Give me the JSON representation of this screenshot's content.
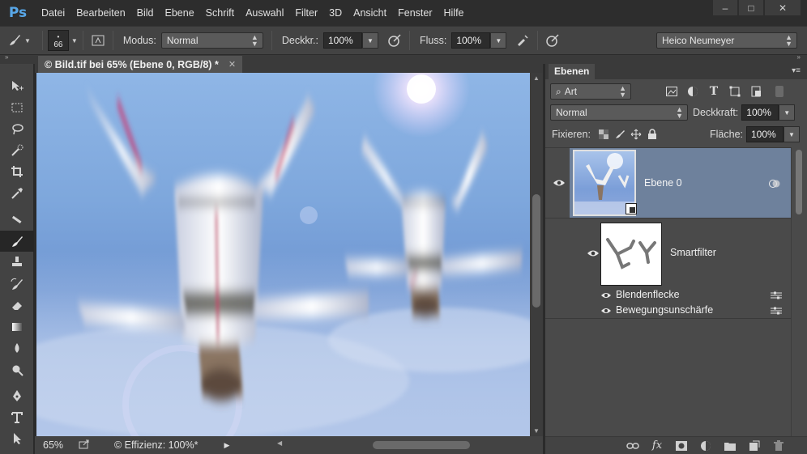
{
  "app": {
    "logo": "Ps"
  },
  "menu": [
    "Datei",
    "Bearbeiten",
    "Bild",
    "Ebene",
    "Schrift",
    "Auswahl",
    "Filter",
    "3D",
    "Ansicht",
    "Fenster",
    "Hilfe"
  ],
  "window_controls": {
    "minimize": "–",
    "maximize": "□",
    "close": "✕"
  },
  "options": {
    "brush_size": "66",
    "mode_label": "Modus:",
    "mode_value": "Normal",
    "opacity_label": "Deckkr.:",
    "opacity_value": "100%",
    "flow_label": "Fluss:",
    "flow_value": "100%",
    "workspace": "Heico Neumeyer"
  },
  "document": {
    "tab_title": "© Bild.tif bei 65% (Ebene 0, RGB/8) *",
    "zoom": "65%",
    "status_info": "© Effizienz: 100%*"
  },
  "layers_panel": {
    "tab": "Ebenen",
    "filter_kind": "Art",
    "blend_mode": "Normal",
    "opacity_label": "Deckkraft:",
    "opacity_value": "100%",
    "lock_label": "Fixieren:",
    "fill_label": "Fläche:",
    "fill_value": "100%",
    "layers": [
      {
        "name": "Ebene 0",
        "visible": true,
        "selected": true
      },
      {
        "name": "Smartfilter",
        "visible": true
      },
      {
        "name": "Blendenflecke",
        "visible": true
      },
      {
        "name": "Bewegungsunschärfe",
        "visible": true
      }
    ]
  },
  "colors": {
    "accent_blue": "#58a7e8",
    "selected_layer": "#6e819c",
    "panel_bg": "#4a4a4a",
    "menubar_bg": "#2d2d2d"
  },
  "icons": {
    "move_tool": "move-icon",
    "marquee_tool": "marquee-icon",
    "lasso_tool": "lasso-icon",
    "quick_select_tool": "quick-select-icon",
    "crop_tool": "crop-icon",
    "eyedropper_tool": "eyedropper-icon",
    "heal_tool": "healing-brush-icon",
    "brush_tool": "brush-icon",
    "stamp_tool": "clone-stamp-icon",
    "history_brush_tool": "history-brush-icon",
    "eraser_tool": "eraser-icon",
    "gradient_tool": "gradient-icon",
    "blur_tool": "blur-icon",
    "dodge_tool": "dodge-icon",
    "pen_tool": "pen-icon",
    "type_tool": "type-icon",
    "path_select_tool": "path-select-icon",
    "shape_tool": "shape-icon"
  }
}
